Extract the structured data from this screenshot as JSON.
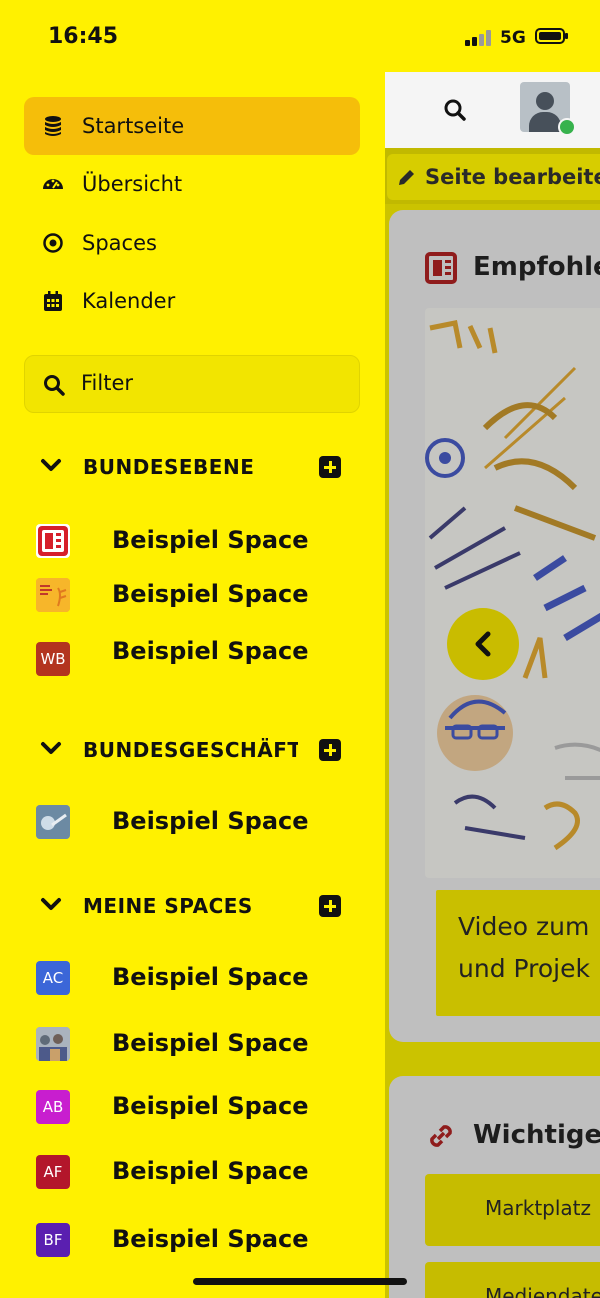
{
  "status_bar": {
    "time": "16:45",
    "network": "5G"
  },
  "drawer": {
    "nav": [
      {
        "label": "Startseite",
        "icon": "database-icon",
        "active": true
      },
      {
        "label": "Übersicht",
        "icon": "dashboard-gauge-icon"
      },
      {
        "label": "Spaces",
        "icon": "dot-circle-icon"
      },
      {
        "label": "Kalender",
        "icon": "calendar-icon"
      }
    ],
    "filter": {
      "label": "Filter",
      "icon": "search-icon"
    },
    "sections": [
      {
        "title": "BUNDESEBENE",
        "spaces": [
          {
            "name": "Beispiel Space",
            "logo": "newspaper-logo"
          },
          {
            "name": "Beispiel Space",
            "logo": "image-logo"
          },
          {
            "name": "Beispiel Space",
            "initials": "WB",
            "color": "#B3341F"
          }
        ]
      },
      {
        "title": "BUNDESGESCHÄFT...",
        "spaces": [
          {
            "name": "Beispiel Space",
            "logo": "photo-logo"
          }
        ]
      },
      {
        "title": "MEINE SPACES",
        "spaces": [
          {
            "name": "Beispiel Space",
            "initials": "AC",
            "color": "#3B66D8"
          },
          {
            "name": "Beispiel Space",
            "logo": "photo-logo"
          },
          {
            "name": "Beispiel Space",
            "initials": "AB",
            "color": "#C81ECF"
          },
          {
            "name": "Beispiel Space",
            "initials": "AF",
            "color": "#B3162B"
          },
          {
            "name": "Beispiel Space",
            "initials": "BF",
            "color": "#5A1FB0"
          }
        ]
      }
    ]
  },
  "main": {
    "edit_button": "Seite bearbeiten",
    "card1": {
      "title": "Empfohle",
      "video_caption": [
        "Video zum",
        "und Projek"
      ]
    },
    "card2": {
      "title": "Wichtige",
      "links": [
        "Marktplatz",
        "Mediendatenba"
      ]
    }
  },
  "colors": {
    "drawer_bg": "#FFF100",
    "active_item": "#F5BE0A"
  }
}
